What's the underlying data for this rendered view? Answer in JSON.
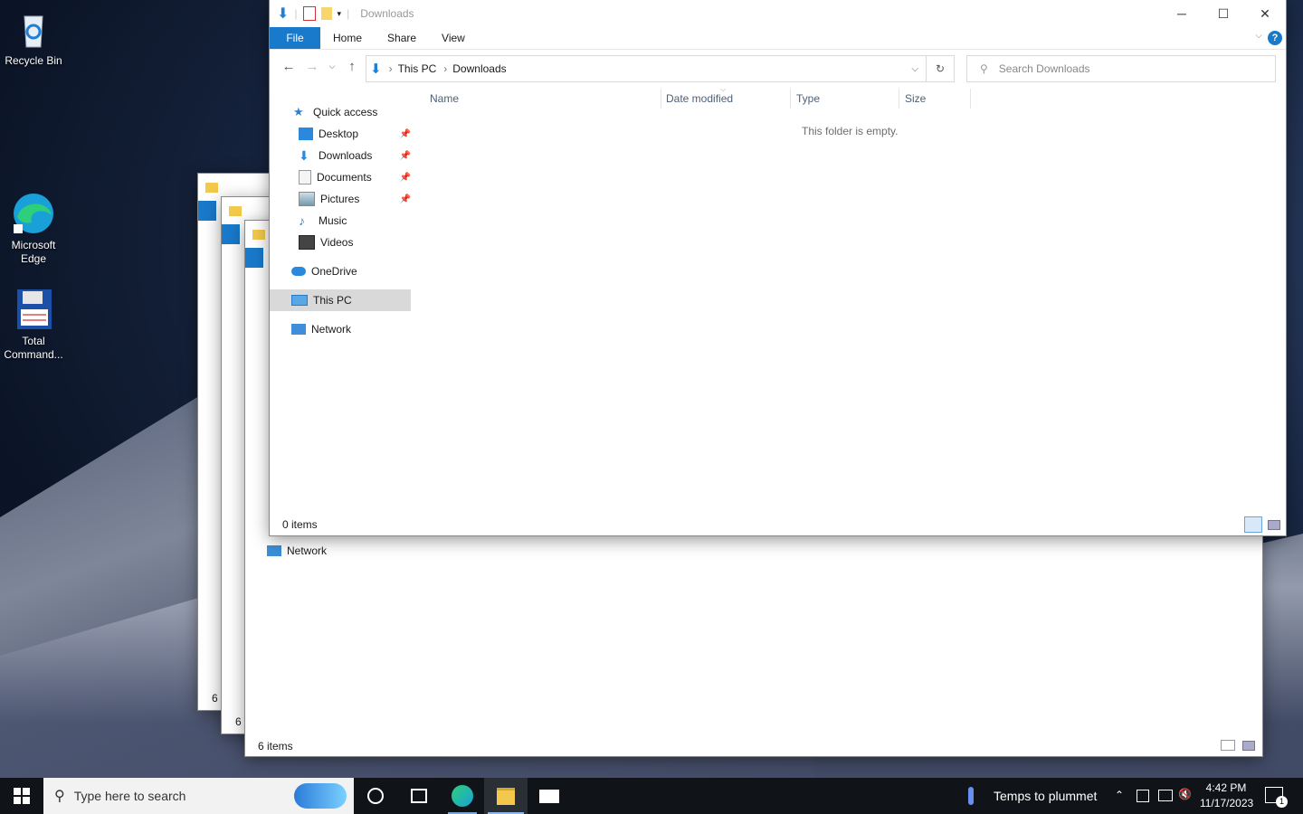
{
  "desktop": {
    "icons": [
      {
        "label": "Recycle Bin"
      },
      {
        "label": "Microsoft Edge"
      },
      {
        "label": "Total Command..."
      }
    ]
  },
  "background_windows": {
    "status_text": "6 items",
    "status_partial_1": "6 i",
    "status_partial_2": "6 i",
    "network_label": "Network"
  },
  "main_window": {
    "title": "Downloads",
    "ribbon": {
      "file": "File",
      "tabs": [
        "Home",
        "Share",
        "View"
      ]
    },
    "breadcrumb": [
      "This PC",
      "Downloads"
    ],
    "search_placeholder": "Search Downloads",
    "columns": [
      "Name",
      "Date modified",
      "Type",
      "Size"
    ],
    "empty_message": "This folder is empty.",
    "status": "0 items",
    "nav": {
      "quick_access": "Quick access",
      "quick_items": [
        "Desktop",
        "Downloads",
        "Documents",
        "Pictures",
        "Music",
        "Videos"
      ],
      "onedrive": "OneDrive",
      "this_pc": "This PC",
      "network": "Network"
    }
  },
  "taskbar": {
    "search_placeholder": "Type here to search",
    "weather": "Temps to plummet",
    "time": "4:42 PM",
    "date": "11/17/2023",
    "notification_count": "1"
  },
  "colors": {
    "accent": "#1979ca",
    "selected_nav": "#d9d9d9",
    "taskbar": "#101418"
  }
}
